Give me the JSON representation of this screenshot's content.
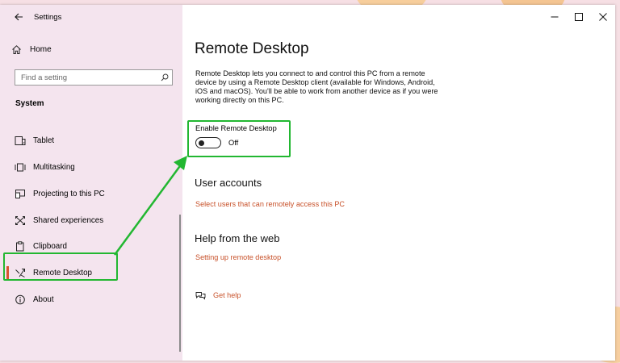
{
  "window": {
    "title": "Settings",
    "minimize_icon": "minimize-icon",
    "maximize_icon": "maximize-icon",
    "close_icon": "close-icon"
  },
  "sidebar": {
    "home_label": "Home",
    "search_placeholder": "Find a setting",
    "section_title": "System",
    "items": [
      {
        "label": "Tablet",
        "icon": "tablet-icon"
      },
      {
        "label": "Multitasking",
        "icon": "multitasking-icon"
      },
      {
        "label": "Projecting to this PC",
        "icon": "projecting-icon"
      },
      {
        "label": "Shared experiences",
        "icon": "shared-experiences-icon"
      },
      {
        "label": "Clipboard",
        "icon": "clipboard-icon"
      },
      {
        "label": "Remote Desktop",
        "icon": "remote-desktop-icon",
        "active": true
      },
      {
        "label": "About",
        "icon": "info-icon"
      }
    ]
  },
  "main": {
    "title": "Remote Desktop",
    "description": "Remote Desktop lets you connect to and control this PC from a remote device by using a Remote Desktop client (available for Windows, Android, iOS and macOS). You'll be able to work from another device as if you were working directly on this PC.",
    "toggle": {
      "label": "Enable Remote Desktop",
      "state_text": "Off",
      "on": false
    },
    "user_accounts": {
      "title": "User accounts",
      "link": "Select users that can remotely access this PC"
    },
    "help": {
      "title": "Help from the web",
      "link": "Setting up remote desktop",
      "get_help": "Get help"
    }
  },
  "colors": {
    "accent": "#c8522b",
    "highlight": "#22b731",
    "sidebar_bg": "#f4e4ee"
  }
}
